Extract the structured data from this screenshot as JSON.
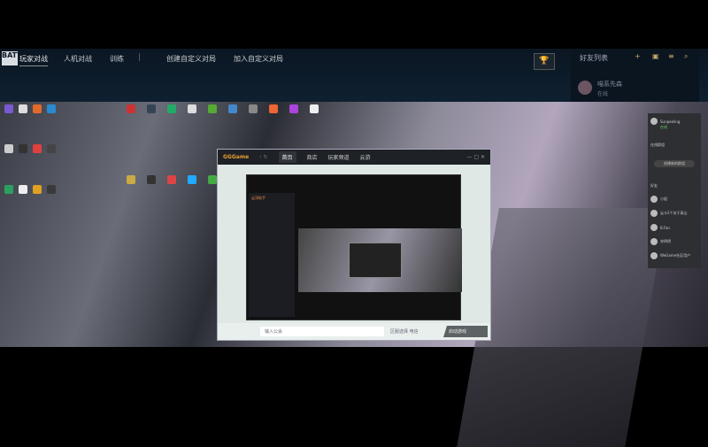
{
  "header": {
    "logo": "BATTLE",
    "nav": [
      "玩家对战",
      "人机对战",
      "训练",
      "创建自定义对局",
      "加入自定义对局"
    ]
  },
  "friends": {
    "title": "好友列表",
    "icons": [
      "add-friend-icon",
      "folder-icon",
      "list-icon",
      "search-icon"
    ],
    "user": {
      "name": "喵系先森",
      "status": "在线"
    }
  },
  "gg": {
    "brand": "GGGame",
    "tabs": [
      "首页",
      "商店",
      "玩家频道",
      "云游"
    ],
    "inner_brand": "云顶助手",
    "search_placeholder": "输入公会",
    "region": "区服选择 电信",
    "launch": "启动游戏"
  },
  "chat": {
    "user": "Sunpeeling",
    "status": "在线",
    "group_title": "在线群组",
    "group_button": "创建新的群组",
    "friends_title": "好友",
    "friends": [
      "小姐",
      "云卡2个关于高山",
      "B.Fan",
      "宋明明",
      "WeGame社区用户"
    ]
  }
}
